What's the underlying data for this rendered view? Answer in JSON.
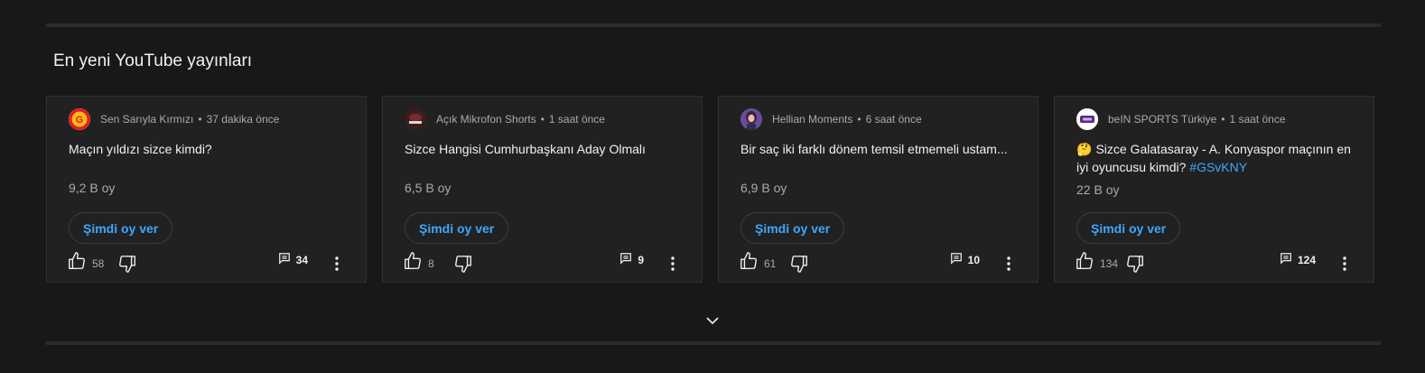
{
  "section": {
    "title": "En yeni YouTube yayınları"
  },
  "cards": [
    {
      "channel": "Sen Sarıyla Kırmızı",
      "time": "37 dakika önce",
      "avatar_icon": "galatasaray-logo-icon",
      "avatar_color": "#e31b23",
      "emoji": "",
      "question": "Maçın yıldızı sizce kimdi?",
      "hashtag": "",
      "votes": "9,2 B oy",
      "vote_button": "Şimdi oy ver",
      "likes": "58",
      "comments": "34"
    },
    {
      "channel": "Açık Mikrofon Shorts",
      "time": "1 saat önce",
      "avatar_icon": "microphone-channel-icon",
      "avatar_color": "#3a1e1e",
      "emoji": "",
      "question": "Sizce Hangisi Cumhurbaşkanı Aday Olmalı",
      "hashtag": "",
      "votes": "6,5 B oy",
      "vote_button": "Şimdi oy ver",
      "likes": "8",
      "comments": "9"
    },
    {
      "channel": "Hellian Moments",
      "time": "6 saat önce",
      "avatar_icon": "character-portrait-icon",
      "avatar_color": "#6a4c9c",
      "emoji": "",
      "question": "Bir saç iki farklı dönem temsil etmemeli ustam...",
      "hashtag": "",
      "votes": "6,9 B oy",
      "vote_button": "Şimdi oy ver",
      "likes": "61",
      "comments": "10"
    },
    {
      "channel": "beIN SPORTS Türkiye",
      "time": "1 saat önce",
      "avatar_icon": "bein-sports-logo-icon",
      "avatar_color": "#5b2a86",
      "emoji": "🤔",
      "question": "Sizce Galatasaray - A. Konyaspor maçının en iyi oyuncusu kimdi?",
      "hashtag": "#GSvKNY",
      "votes": "22 B oy",
      "vote_button": "Şimdi oy ver",
      "likes": "134",
      "comments": "124"
    }
  ],
  "colors": {
    "background": "#181818",
    "card": "#212121",
    "accent": "#3ea6ff"
  },
  "icons": {
    "like": "thumbs-up-icon",
    "dislike": "thumbs-down-icon",
    "comment": "comment-icon",
    "more": "more-vert-icon",
    "expand": "chevron-down-icon"
  }
}
